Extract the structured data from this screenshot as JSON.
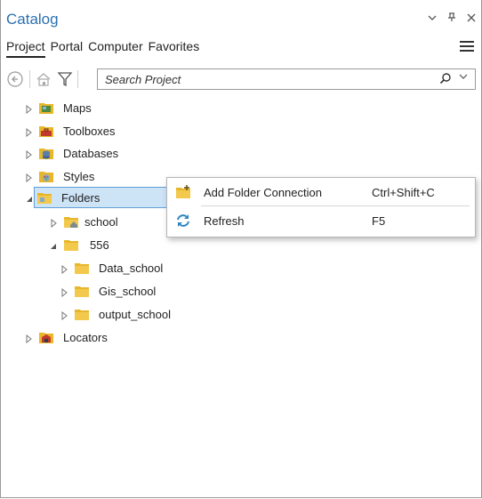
{
  "window": {
    "title": "Catalog",
    "controls": [
      "chevron-down-icon",
      "pin-icon",
      "close-icon"
    ]
  },
  "tabs": [
    {
      "label": "Project",
      "active": true
    },
    {
      "label": "Portal",
      "active": false
    },
    {
      "label": "Computer",
      "active": false
    },
    {
      "label": "Favorites",
      "active": false
    }
  ],
  "search": {
    "placeholder": "Search Project"
  },
  "tree": {
    "items": [
      {
        "label": "Maps",
        "icon": "maps-icon"
      },
      {
        "label": "Toolboxes",
        "icon": "toolbox-icon"
      },
      {
        "label": "Databases",
        "icon": "database-icon"
      },
      {
        "label": "Styles",
        "icon": "styles-icon"
      },
      {
        "label": "Folders",
        "icon": "folder-icon",
        "selected": true,
        "expanded": true
      },
      {
        "label": "school",
        "icon": "folder-home-icon"
      },
      {
        "label": "556",
        "icon": "folder-icon",
        "expanded": true
      },
      {
        "label": "Data_school",
        "icon": "folder-icon"
      },
      {
        "label": "Gis_school",
        "icon": "folder-icon"
      },
      {
        "label": "output_school",
        "icon": "folder-icon"
      },
      {
        "label": "Locators",
        "icon": "locator-icon"
      }
    ]
  },
  "context_menu": {
    "items": [
      {
        "label": "Add Folder Connection",
        "shortcut": "Ctrl+Shift+C",
        "icon": "add-folder-icon"
      },
      {
        "label": "Refresh",
        "shortcut": "F5",
        "icon": "refresh-icon"
      }
    ]
  },
  "colors": {
    "accent": "#2b6fb0",
    "selection_bg": "#cde3f6",
    "selection_border": "#5f9fd6",
    "folder": "#e8b62b"
  }
}
